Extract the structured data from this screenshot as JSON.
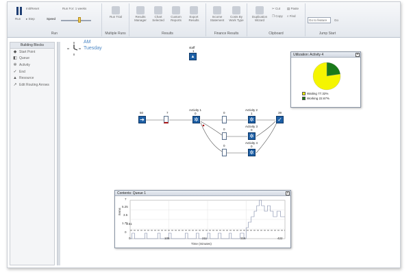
{
  "ribbon": {
    "run_label": "Run",
    "init_reset": "Init/Reset",
    "step_label": "Step",
    "speed_label": "Speed",
    "run_for": "Run For: 1 weeks",
    "run_trial": "Run\nTrial",
    "results_manager": "Results\nManager",
    "chart_selected": "Chart\nSelected",
    "custom_reports": "Custom\nReports",
    "export_results": "Export\nResults",
    "income_statement": "Income\nStatement",
    "costs_by_work_type": "Costs By\nWork Type",
    "duplication_wizard": "Duplication\nWizard",
    "cut": "Cut",
    "copy": "Copy",
    "paste": "Paste",
    "find": "Find",
    "jump_placeholder": "Go to feature",
    "go": "Go",
    "groups": [
      "Run",
      "Multiple Runs",
      "Results",
      "Finance Results",
      "Clipboard",
      "Jump Start"
    ]
  },
  "sidebar": {
    "title": "Building Blocks",
    "items": [
      {
        "label": "Start Point",
        "icon": "start-point-icon"
      },
      {
        "label": "Queue",
        "icon": "queue-icon"
      },
      {
        "label": "Activity",
        "icon": "activity-icon"
      },
      {
        "label": "End",
        "icon": "end-icon"
      },
      {
        "label": "Resource",
        "icon": "resource-icon"
      },
      {
        "label": "Edit Routing Arrows",
        "icon": "edit-routing-icon"
      }
    ]
  },
  "canvas": {
    "clock_time": "AM",
    "clock_day": "Tuesday",
    "resource": {
      "label": "staff",
      "value": "1"
    },
    "start": {
      "value": "50"
    },
    "queue1": {
      "value": "7"
    },
    "activity1": {
      "label": "Activity 1",
      "value": "0"
    },
    "queue2": {
      "value": "0"
    },
    "queue3": {
      "value": "0"
    },
    "queue4": {
      "value": "0"
    },
    "activity2": {
      "label": "Activity 2",
      "value": "1"
    },
    "activity3": {
      "label": "Activity 3",
      "value": "0"
    },
    "activity4": {
      "label": "Activity 4",
      "value": "0"
    },
    "end": {
      "value": "39"
    }
  },
  "util_window": {
    "title": "Utilization: Activity 4",
    "waiting_label": "Waiting 77.32%",
    "working_label": "Working 22.67%",
    "colors": {
      "waiting": "#f5f500",
      "working": "#1a7a1a"
    }
  },
  "contents_window": {
    "title": "Contents: Queue 1",
    "xlabel": "Time (minutes)",
    "ylabel": "Items",
    "y_ticks": [
      "7",
      "5.25",
      "3.5",
      "1.75",
      "0"
    ],
    "x_ticks": [
      "0",
      "105",
      "211",
      "316",
      "422"
    ],
    "avg_label": "1.51"
  },
  "chart_data": [
    {
      "type": "pie",
      "title": "Utilization: Activity 4",
      "labels": [
        "Waiting",
        "Working"
      ],
      "values": [
        77.32,
        22.67
      ],
      "colors": [
        "#f5f500",
        "#1a7a1a"
      ],
      "legend": "bottom"
    },
    {
      "type": "line",
      "title": "Contents: Queue 1",
      "xlabel": "Time (minutes)",
      "ylabel": "Items",
      "xlim": [
        0,
        422
      ],
      "ylim": [
        0,
        7
      ],
      "mean_line": 1.51,
      "series": [
        {
          "x": [
            0,
            5,
            5,
            12,
            12,
            40,
            40,
            46,
            46,
            75,
            75,
            82,
            82,
            105,
            105,
            112,
            112,
            150,
            150,
            157,
            157,
            180,
            180,
            187,
            187,
            211,
            211,
            218,
            218,
            240,
            240,
            248,
            248,
            270,
            270,
            276,
            276,
            300,
            300,
            310,
            310,
            316,
            316,
            322,
            322,
            330,
            330,
            338,
            338,
            345,
            345,
            352,
            352,
            358,
            358,
            366,
            366,
            374,
            374,
            382,
            382,
            390,
            390,
            400,
            400,
            410,
            410,
            422
          ],
          "y": [
            0,
            0,
            1,
            1,
            0,
            0,
            1,
            1,
            0,
            0,
            1,
            1,
            0,
            0,
            1,
            1,
            0,
            0,
            1,
            1,
            0,
            0,
            1,
            1,
            0,
            0,
            1,
            1,
            0,
            0,
            1,
            1,
            0,
            0,
            1,
            1,
            0,
            0,
            1,
            1,
            0,
            0,
            2,
            2,
            3,
            3,
            4,
            4,
            5,
            5,
            6,
            6,
            7,
            7,
            6,
            6,
            5,
            5,
            6,
            6,
            5,
            5,
            4,
            4,
            5,
            5,
            4,
            4
          ]
        }
      ]
    }
  ]
}
